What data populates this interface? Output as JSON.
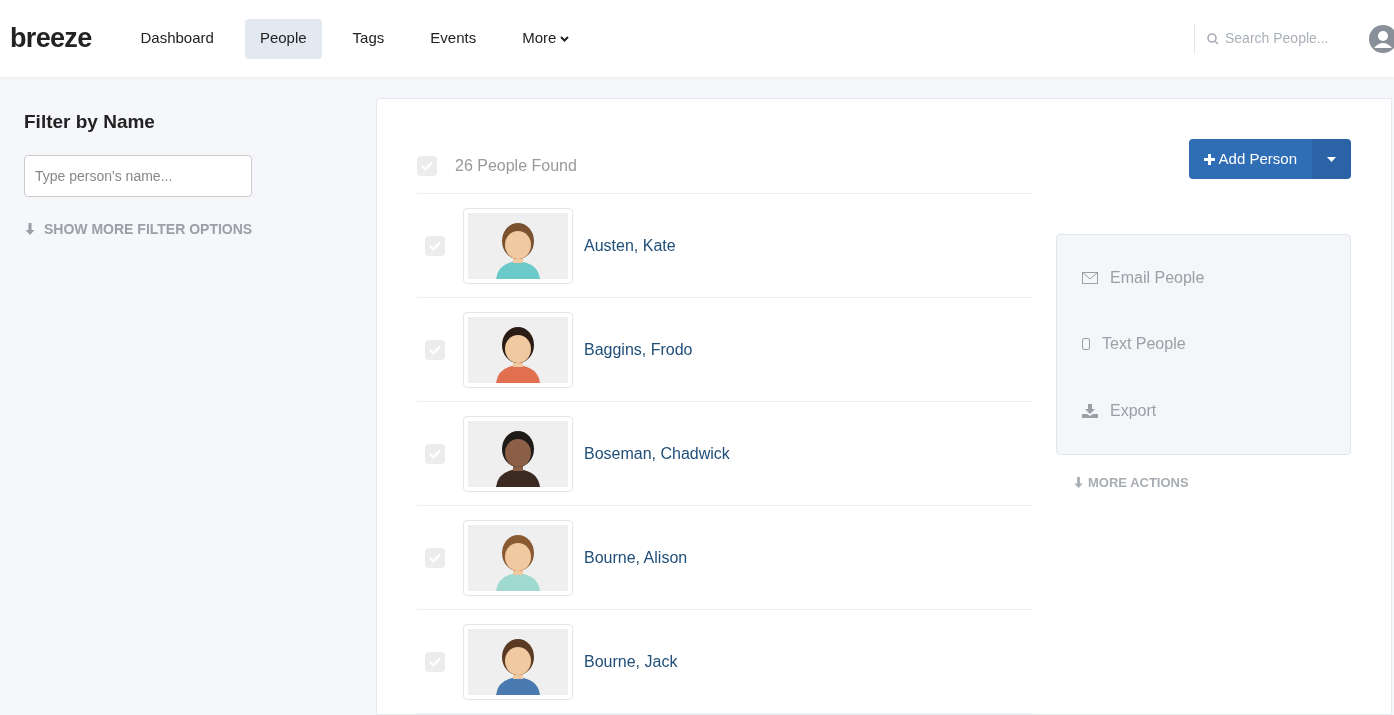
{
  "logo": "breeze",
  "nav": [
    {
      "label": "Dashboard",
      "selected": false
    },
    {
      "label": "People",
      "selected": true
    },
    {
      "label": "Tags",
      "selected": false
    },
    {
      "label": "Events",
      "selected": false
    },
    {
      "label": "More",
      "selected": false,
      "kind": "dropdown"
    }
  ],
  "search": {
    "placeholder": "Search People..."
  },
  "filter": {
    "title": "Filter by Name",
    "placeholder": "Type person's name...",
    "more": "SHOW MORE FILTER OPTIONS"
  },
  "results": {
    "count": "26 People Found",
    "all_checked": false
  },
  "add_button": {
    "label": "Add Person"
  },
  "people": [
    {
      "name": "Austen, Kate",
      "checked": false
    },
    {
      "name": "Baggins, Frodo",
      "checked": false
    },
    {
      "name": "Boseman, Chadwick",
      "checked": false
    },
    {
      "name": "Bourne, Alison",
      "checked": false
    },
    {
      "name": "Bourne, Jack",
      "checked": false
    }
  ],
  "actions": [
    {
      "label": "Email People",
      "kind": "email"
    },
    {
      "label": "Text People",
      "kind": "text"
    },
    {
      "label": "Export",
      "kind": "export"
    }
  ],
  "more_actions": "MORE ACTIONS"
}
